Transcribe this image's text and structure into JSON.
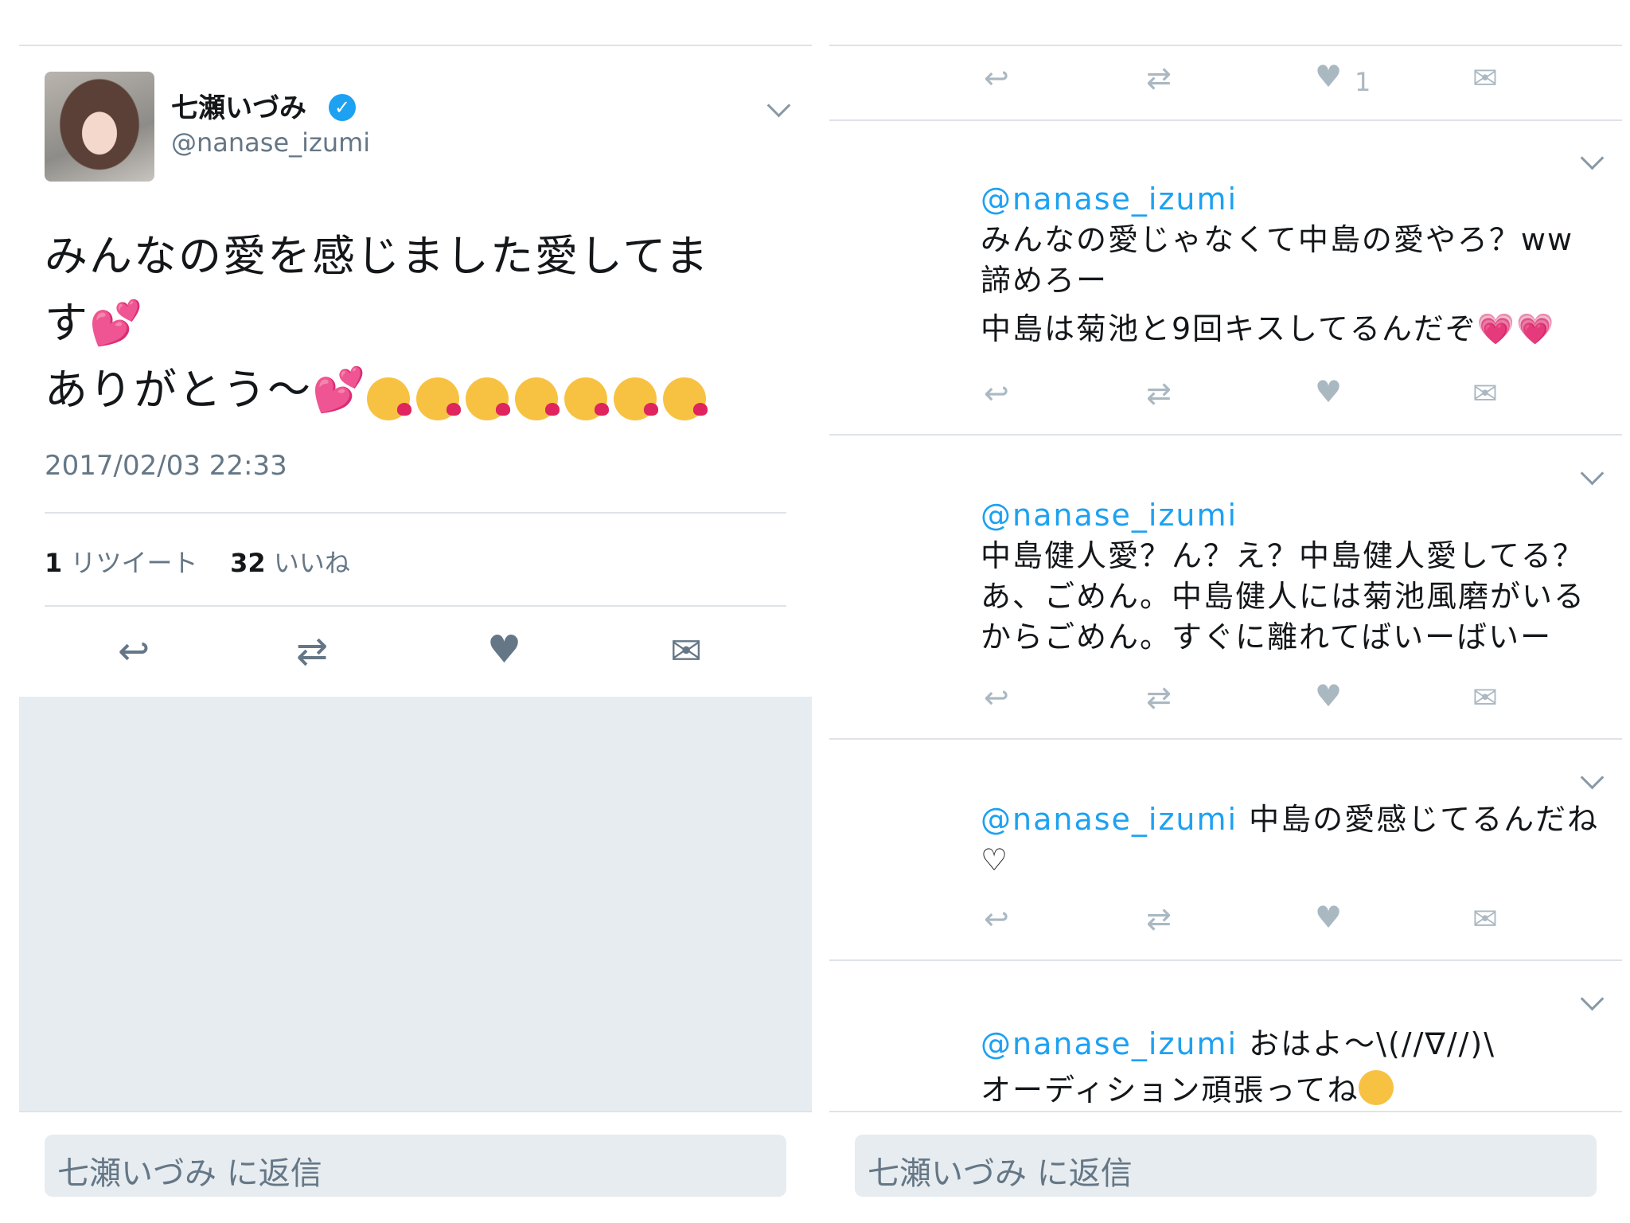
{
  "main_tweet": {
    "author_name": "七瀬いづみ",
    "handle": "@nanase_izumi",
    "text_lines": [
      "みんなの愛を感じました愛してま",
      "す",
      "ありがとう〜"
    ],
    "emoji_names": [
      "two-hearts",
      "kissing-heart"
    ],
    "timestamp": "2017/02/03 22:33",
    "retweet_count": "1",
    "retweet_label": "リツイート",
    "like_count": "32",
    "like_label": "いいね"
  },
  "reply_input": {
    "placeholder": "七瀬いづみ に返信"
  },
  "top_actions": {
    "like_count": "1"
  },
  "replies": [
    {
      "mention": "@nanase_izumi",
      "lines": [
        "みんなの愛じゃなくて中島の愛やろ？ww",
        "諦めろー",
        "中島は菊池と9回キスしてるんだぞ"
      ]
    },
    {
      "mention": "@nanase_izumi",
      "lines": [
        "中島健人愛？ん？え？中島健人愛してる？",
        "あ、ごめん。中島健人には菊池風磨がいる",
        "からごめん。すぐに離れてばいーばいー"
      ]
    },
    {
      "mention": "@nanase_izumi",
      "inline_text": " 中島の愛感じてるんだね",
      "second_line": "♡"
    },
    {
      "mention": "@nanase_izumi",
      "inline_text": " おはよ〜\\(//∇//)\\",
      "second_line": "オーディション頑張ってね"
    }
  ],
  "colors": {
    "link_blue": "#1da1f2",
    "text": "#14171a",
    "muted": "#657786",
    "icon_gray": "#aab8c2",
    "divider": "#dfe3e7",
    "gray_bg": "#e6ecf0"
  },
  "icons": [
    "reply-icon",
    "retweet-icon",
    "like-icon",
    "message-icon",
    "chevron-down-icon",
    "verified-icon"
  ]
}
